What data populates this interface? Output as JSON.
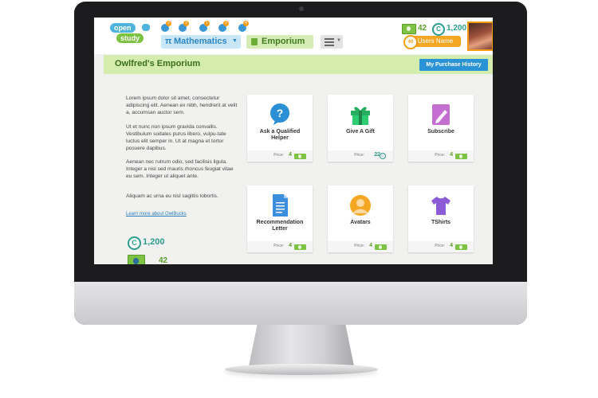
{
  "brand": {
    "logo_top": "open",
    "logo_bottom": "study"
  },
  "header": {
    "notifications": [
      "2",
      "3",
      "1",
      "2",
      "4"
    ],
    "nav": {
      "subject_icon": "π",
      "subject": "Mathematics",
      "emporium": "Emporium"
    },
    "owlbucks": "42",
    "coins": "1,200",
    "coin_symbol": "C",
    "user_level": "40",
    "user_name": "Users Name"
  },
  "titlebar": {
    "title": "Owlfred's Emporium",
    "history_button": "My Purchase History"
  },
  "intro": {
    "paragraphs": [
      "Lorem ipsum dolor sit amet, consectetur adipiscing elit. Aenean ex nibh, hendrerit at velit a, accumsan auctor sem.",
      "Ut et nunc non ipsum gravida convallis. Vestibulum sodales purus libero, vulpu-tate luctus elit semper in. Ut at magna et tortor posuere dapibus.",
      "Aenean nec rutrum odio, sed facilisis ligula. Integer a nisl sed mauris rhoncus feugiat vitae eu sem. Integer ut aliquet ante.",
      "Aliquam ac urna eu nisl sagittis lobortis."
    ],
    "learn_more": "Learn more about OwlBucks"
  },
  "balance": {
    "coins": "1,200",
    "owlbucks": "42"
  },
  "items": [
    {
      "name": "Ask a Qualified Helper",
      "price_label": "Price:",
      "price": "4",
      "currency": "owlbucks",
      "icon": "question-bubble-icon"
    },
    {
      "name": "Give A Gift",
      "price_label": "Price:",
      "price": "22",
      "currency": "coins",
      "icon": "gift-icon"
    },
    {
      "name": "Subscribe",
      "price_label": "Price:",
      "price": "4",
      "currency": "owlbucks",
      "icon": "pencil-card-icon"
    },
    {
      "name": "Recommendation Letter",
      "price_label": "Price:",
      "price": "4",
      "currency": "owlbucks",
      "icon": "document-icon"
    },
    {
      "name": "Avatars",
      "price_label": "Price:",
      "price": "4",
      "currency": "owlbucks",
      "icon": "person-avatar-icon"
    },
    {
      "name": "TShirts",
      "price_label": "Price:",
      "price": "4",
      "currency": "owlbucks",
      "icon": "tshirt-icon"
    }
  ],
  "colors": {
    "primary_blue": "#2a93d5",
    "green": "#7ec243",
    "teal": "#2a9d8f",
    "orange": "#f5a623",
    "title_bar": "#d4ecae"
  }
}
